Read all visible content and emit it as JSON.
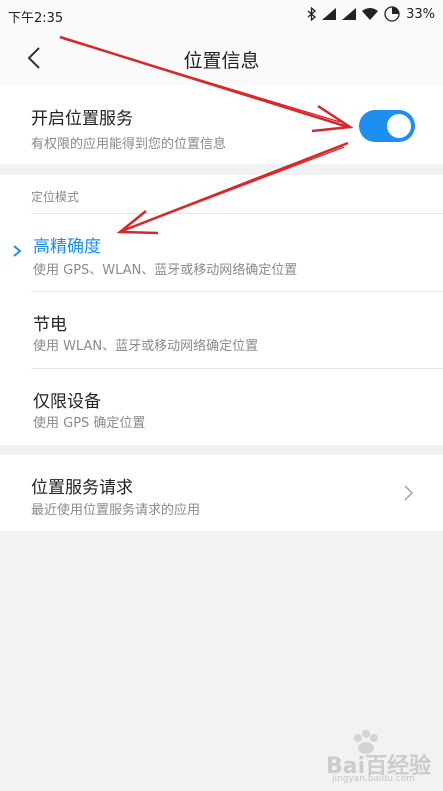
{
  "status_bar": {
    "time": "下午2:35",
    "battery": "33%",
    "icons": [
      "bluetooth-icon",
      "signal-icon",
      "signal-icon",
      "wifi-icon",
      "battery-icon"
    ]
  },
  "header": {
    "title": "位置信息",
    "back_icon": "back-arrow-icon"
  },
  "location_service": {
    "title": "开启位置服务",
    "subtitle": "有权限的应用能得到您的位置信息",
    "toggle_on": true
  },
  "mode_section": {
    "label": "定位模式",
    "options": [
      {
        "title": "高精确度",
        "subtitle": "使用 GPS、WLAN、蓝牙或移动网络确定位置",
        "selected": true
      },
      {
        "title": "节电",
        "subtitle": "使用 WLAN、蓝牙或移动网络确定位置",
        "selected": false
      },
      {
        "title": "仅限设备",
        "subtitle": "使用 GPS 确定位置",
        "selected": false
      }
    ]
  },
  "requests": {
    "title": "位置服务请求",
    "subtitle": "最近使用位置服务请求的应用",
    "chevron_icon": "chevron-right-icon"
  },
  "watermark": {
    "text": "Bai百经验",
    "url": "jingyan.baidu.com"
  },
  "colors": {
    "accent": "#1e8ef0",
    "annotation_arrow": "#d9262b",
    "background": "#f2f2f2"
  }
}
